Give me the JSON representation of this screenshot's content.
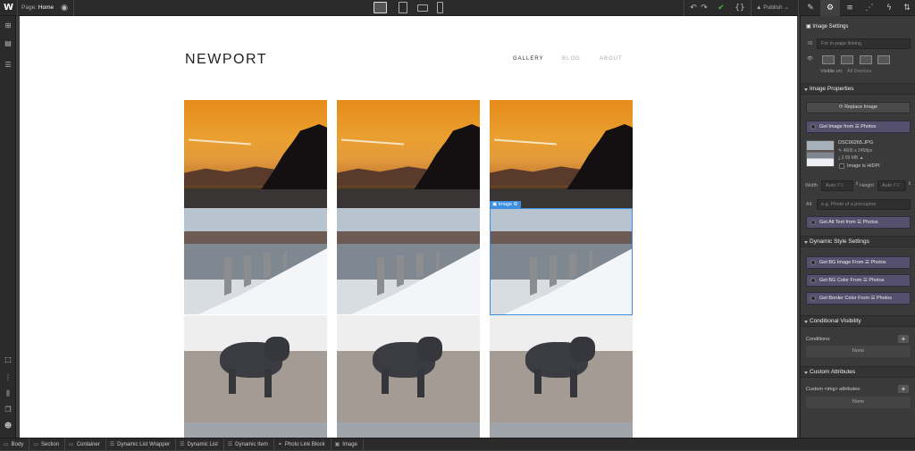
{
  "topbar": {
    "page_prefix": "Page:",
    "page_name": "Home",
    "publish_label": "Publish"
  },
  "site": {
    "brand": "NEWPORT",
    "nav": [
      "GALLERY",
      "BLOG",
      "ABOUT"
    ]
  },
  "canvas": {
    "selected_tag": "Image"
  },
  "breadcrumbs": [
    "Body",
    "Section",
    "Container",
    "Dynamic List Wrapper",
    "Dynamic List",
    "Dynamic Item",
    "Photo Link Block",
    "Image"
  ],
  "panel": {
    "title": "Image Settings",
    "id_label": "ID",
    "id_placeholder": "For in-page linking",
    "visible_on_label": "Visible on:",
    "visible_on_value": "All Devices",
    "image_properties": {
      "header": "Image Properties",
      "replace_button": "Replace Image",
      "get_image_from": "Get Image from",
      "source": "Photos",
      "file_name": "DSC00265.JPG",
      "dimensions": "4606 x 2458px",
      "file_size": "2.09 MB",
      "hidpi_label": "Image is HiDPI",
      "width_label": "Width",
      "width_value": "Auto",
      "width_unit": "PX",
      "height_label": "Height",
      "height_value": "Auto",
      "height_unit": "PX",
      "alt_label": "Alt",
      "alt_placeholder": "e.g. Photo of a porcupine",
      "alt_text_from": "Get Alt Text from"
    },
    "dynamic_style": {
      "header": "Dynamic Style Settings",
      "bg_image": "Get BG Image From",
      "bg_color": "Get BG Color From",
      "border_color": "Get Border Color From"
    },
    "conditional_visibility": {
      "header": "Conditional Visibility",
      "conditions_label": "Conditions:",
      "conditions_value": "None"
    },
    "custom_attributes": {
      "header": "Custom Attributes",
      "attributes_label": "Custom <img> attributes:",
      "attributes_value": "None"
    }
  },
  "colors": {
    "selection": "#3c8fe0",
    "purple_button": "#55506e",
    "dark_bg": "#2b2b2b"
  }
}
